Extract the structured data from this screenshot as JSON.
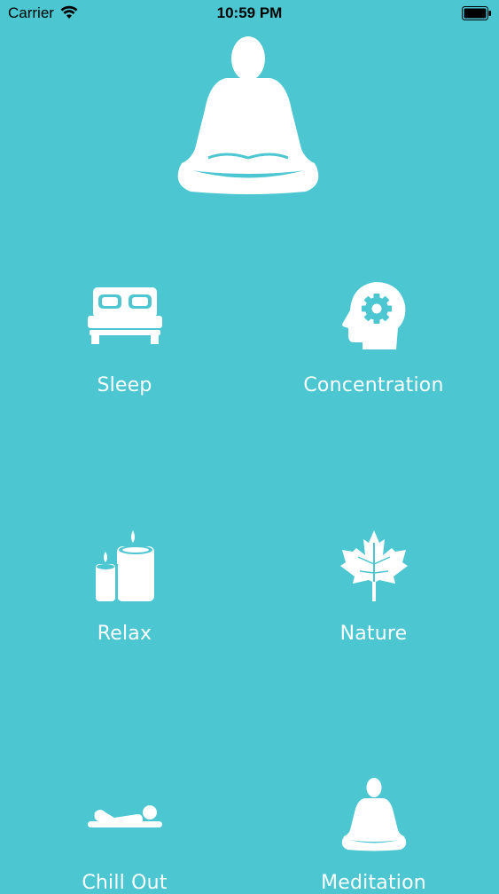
{
  "status_bar": {
    "carrier": "Carrier",
    "time": "10:59 PM"
  },
  "hero": {
    "icon": "meditation-person-icon"
  },
  "categories": [
    {
      "label": "Sleep",
      "icon": "bed-icon"
    },
    {
      "label": "Concentration",
      "icon": "brain-gear-icon"
    },
    {
      "label": "Relax",
      "icon": "candles-icon"
    },
    {
      "label": "Nature",
      "icon": "maple-leaf-icon"
    },
    {
      "label": "Chill Out",
      "icon": "lying-person-icon"
    },
    {
      "label": "Meditation",
      "icon": "meditation-icon"
    }
  ],
  "colors": {
    "background": "#4cc6d1",
    "foreground": "#ffffff"
  }
}
